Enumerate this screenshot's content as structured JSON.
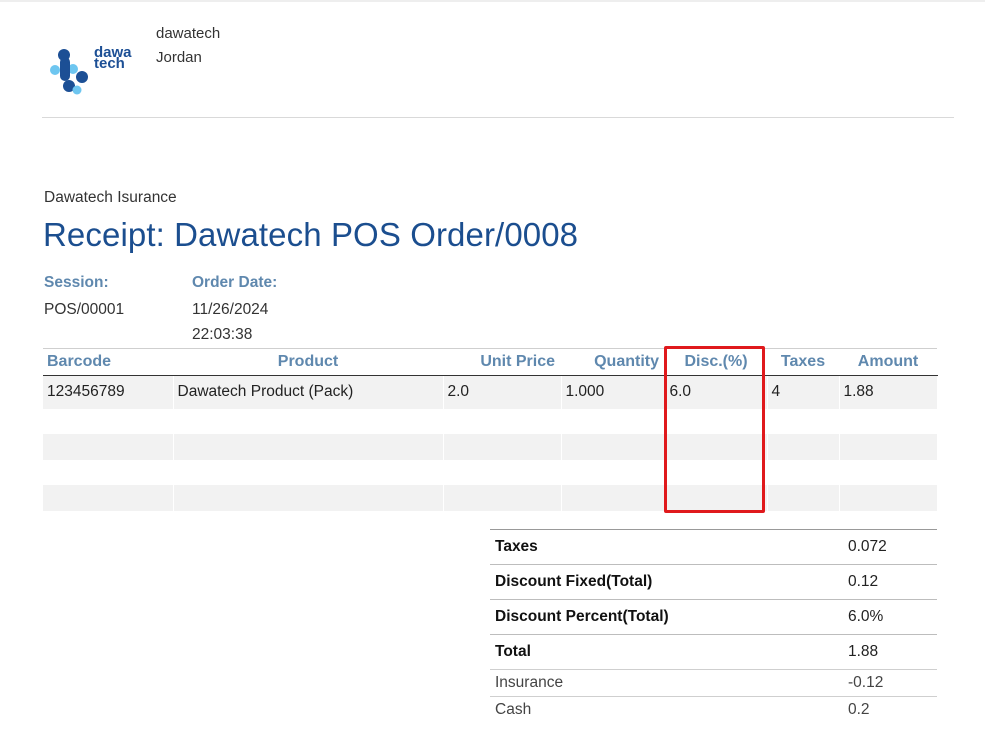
{
  "company": {
    "logo_text_line1": "dawa",
    "logo_text_line2": "tech",
    "name": "dawatech",
    "country": "Jordan"
  },
  "document": {
    "subtitle": "Dawatech Isurance",
    "title": "Receipt: Dawatech POS Order/0008"
  },
  "info": {
    "session_label": "Session:",
    "session_value": "POS/00001",
    "date_label": "Order Date:",
    "date_value": "11/26/2024",
    "time_value": "22:03:38"
  },
  "lines": {
    "headers": [
      "Barcode",
      "Product",
      "Unit Price",
      "Quantity",
      "Disc.(%)",
      "Taxes",
      "Amount"
    ],
    "rows": [
      [
        "123456789",
        "Dawatech Product (Pack)",
        "2.0",
        "1.000",
        "6.0",
        "4",
        "1.88"
      ]
    ]
  },
  "totals": {
    "main": [
      {
        "label": "Taxes",
        "value": "0.072"
      },
      {
        "label": "Discount Fixed(Total)",
        "value": "0.12"
      },
      {
        "label": "Discount Percent(Total)",
        "value": "6.0%"
      },
      {
        "label": "Total",
        "value": "1.88"
      }
    ],
    "payments": [
      {
        "label": "Insurance",
        "value": "-0.12"
      },
      {
        "label": "Cash",
        "value": "0.2"
      }
    ]
  },
  "colors": {
    "title": "#1b4e8f",
    "header_label": "#5f88ae",
    "highlight_box": "#e0191c",
    "logo_dark": "#1c4f95",
    "logo_light": "#6ec6f0"
  }
}
